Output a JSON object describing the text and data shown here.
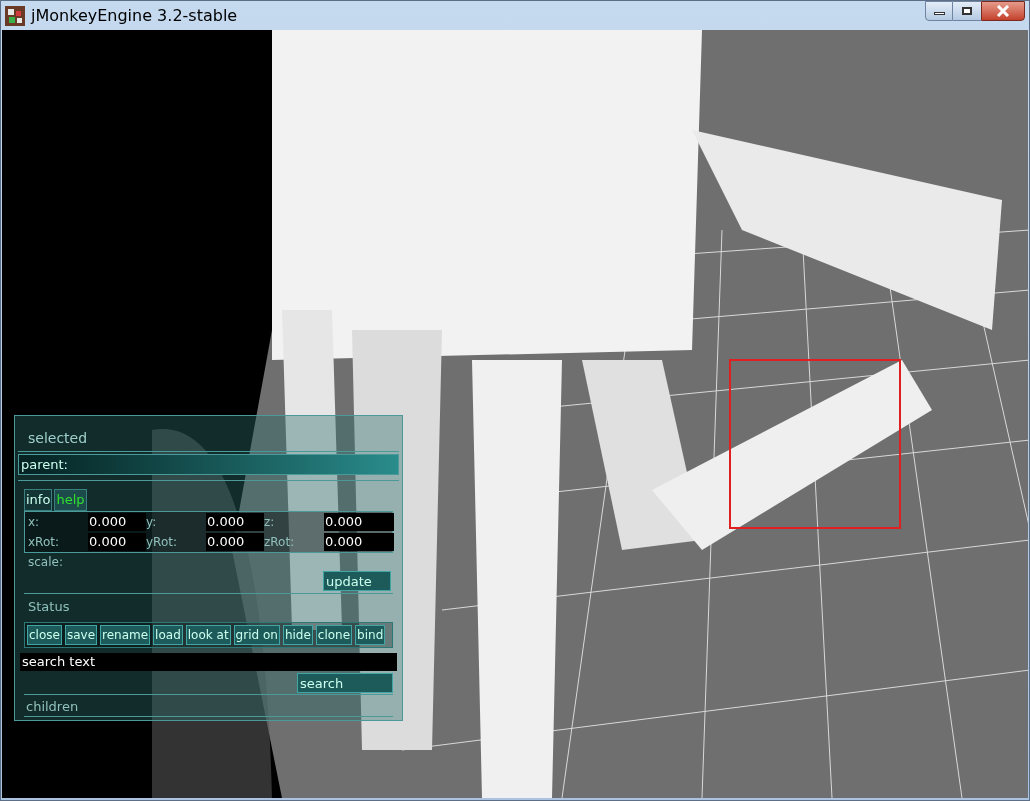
{
  "window": {
    "title": "jMonkeyEngine 3.2-stable"
  },
  "panel": {
    "title": "selected",
    "parent_label": "parent:",
    "tabs": [
      {
        "label": "info",
        "selected": false
      },
      {
        "label": "help",
        "selected": true
      }
    ],
    "fields": [
      {
        "label": "x:",
        "value": "0.000"
      },
      {
        "label": "y:",
        "value": "0.000"
      },
      {
        "label": "z:",
        "value": "0.000"
      },
      {
        "label": "xRot:",
        "value": "0.000"
      },
      {
        "label": "yRot:",
        "value": "0.000"
      },
      {
        "label": "zRot:",
        "value": "0.000"
      }
    ],
    "scale_label": "scale:",
    "update_button": "update",
    "status_label": "Status",
    "actions": [
      "close",
      "save",
      "rename",
      "load",
      "look at",
      "grid on",
      "hide",
      "clone",
      "bind"
    ],
    "search_value": "search text",
    "search_button": "search",
    "children_label": "children"
  }
}
